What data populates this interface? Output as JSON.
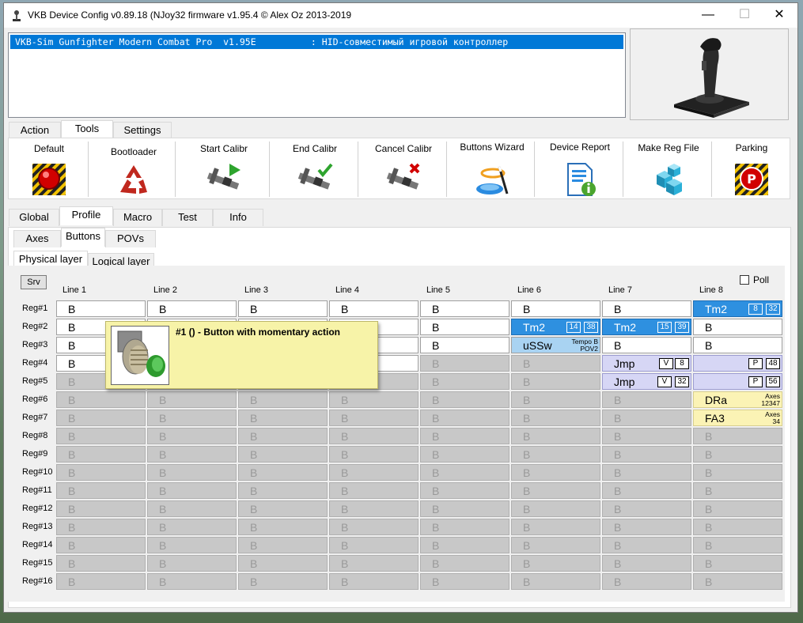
{
  "window": {
    "title": "VKB Device Config v0.89.18 (NJoy32 firmware v1.95.4 © Alex Oz 2013-2019",
    "minimize": "—",
    "maximize": "☐",
    "close": "✕"
  },
  "device_list": {
    "selected_row": "VKB-Sim Gunfighter Modern Combat Pro  v1.95E          : HID-совместимый игровой контроллер"
  },
  "main_tabs": [
    "Action",
    "Tools",
    "Settings"
  ],
  "main_tab_active": "Tools",
  "tools": [
    {
      "label": "Default",
      "icon": "red-button-icon"
    },
    {
      "label": "Bootloader",
      "icon": "recycle-icon"
    },
    {
      "label": "Start Calibr",
      "icon": "caliper-play-icon"
    },
    {
      "label": "End Calibr",
      "icon": "caliper-check-icon"
    },
    {
      "label": "Cancel Calibr",
      "icon": "caliper-cross-icon"
    },
    {
      "label": "Buttons Wizard",
      "icon": "wizard-wand-icon"
    },
    {
      "label": "Device Report",
      "icon": "report-document-icon"
    },
    {
      "label": "Make Reg File",
      "icon": "registry-cubes-icon"
    },
    {
      "label": "Parking",
      "icon": "parking-sign-icon"
    }
  ],
  "config_tabs": [
    "Global",
    "Profile",
    "Macro",
    "Test",
    "Info"
  ],
  "config_tab_active": "Profile",
  "profile_tabs": [
    "Axes",
    "Buttons",
    "POVs"
  ],
  "profile_tab_active": "Buttons",
  "layer_tabs": [
    "Physical layer",
    "Logical layer"
  ],
  "layer_tab_active": "Physical layer",
  "srv_label": "Srv",
  "poll_label": "Poll",
  "poll_checked": false,
  "columns": [
    "Line 1",
    "Line 2",
    "Line 3",
    "Line 4",
    "Line 5",
    "Line 6",
    "Line 7",
    "Line 8"
  ],
  "rows": [
    "Reg#1",
    "Reg#2",
    "Reg#3",
    "Reg#4",
    "Reg#5",
    "Reg#6",
    "Reg#7",
    "Reg#8",
    "Reg#9",
    "Reg#10",
    "Reg#11",
    "Reg#12",
    "Reg#13",
    "Reg#14",
    "Reg#15",
    "Reg#16"
  ],
  "default_label": "B",
  "special_cells": {
    "0-7": {
      "text": "Tm2",
      "style": "blue",
      "badges": [
        "8",
        "32"
      ]
    },
    "1-5": {
      "text": "Tm2",
      "style": "blue",
      "badges": [
        "14",
        "38"
      ]
    },
    "1-6": {
      "text": "Tm2",
      "style": "blue",
      "badges": [
        "15",
        "39"
      ]
    },
    "2-5": {
      "text": "uSSw",
      "style": "lblue",
      "small": [
        "Tempo B",
        "POV2"
      ]
    },
    "3-6": {
      "text": "Jmp",
      "style": "lav",
      "badges": [
        "V",
        "8"
      ]
    },
    "3-7": {
      "text": "",
      "style": "lav",
      "badges": [
        "P",
        "48"
      ]
    },
    "4-6": {
      "text": "Jmp",
      "style": "lav",
      "badges": [
        "V",
        "32"
      ]
    },
    "4-7": {
      "text": "",
      "style": "lav",
      "badges": [
        "P",
        "56"
      ]
    },
    "5-7": {
      "text": "DRa",
      "style": "yel",
      "small": [
        "Axes",
        "12347"
      ]
    },
    "6-7": {
      "text": "FA3",
      "style": "yel",
      "small": [
        "Axes",
        "34"
      ]
    }
  },
  "enabled_cells": [
    "0-0",
    "0-1",
    "0-2",
    "0-3",
    "0-4",
    "0-5",
    "0-6",
    "1-0",
    "1-1",
    "1-2",
    "1-3",
    "1-4",
    "1-7",
    "2-0",
    "2-1",
    "2-2",
    "2-3",
    "2-4",
    "2-6",
    "2-7",
    "3-0",
    "3-1",
    "3-2",
    "3-3"
  ],
  "colors": {
    "accent": "#0078d7",
    "tm2_blue": "#2e90e0",
    "disabled": "#c8c8c8",
    "tooltip": "#f7f3a8"
  },
  "tooltip": {
    "text": "#1 () - Button with momentary action",
    "icon": "green-pushbutton-icon"
  }
}
